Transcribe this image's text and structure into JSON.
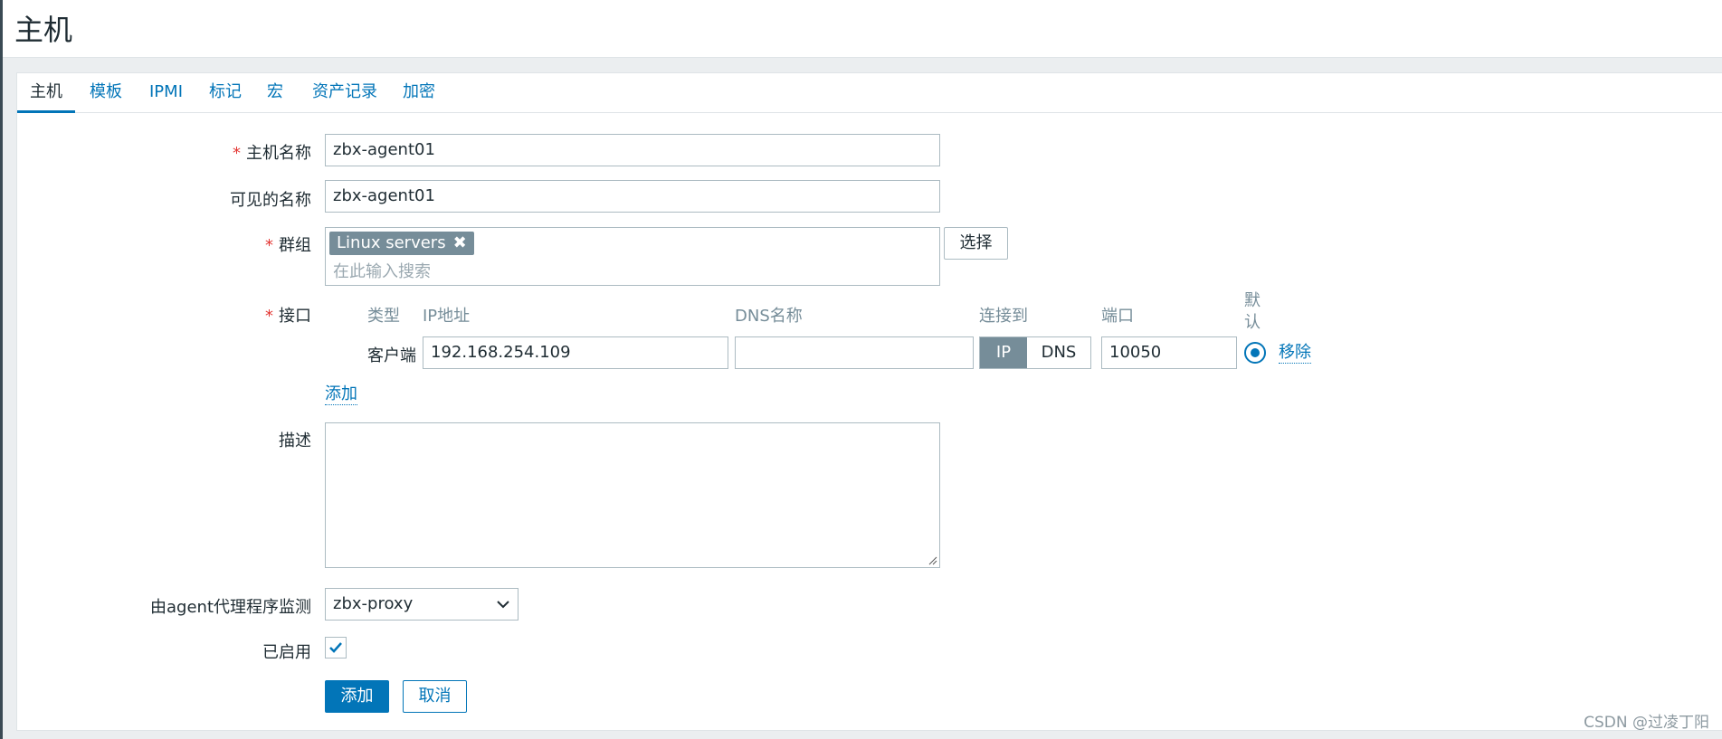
{
  "page": {
    "title": "主机"
  },
  "tabs": [
    {
      "label": "主机",
      "active": true
    },
    {
      "label": "模板"
    },
    {
      "label": "IPMI"
    },
    {
      "label": "标记"
    },
    {
      "label": "宏"
    },
    {
      "label": "资产记录"
    },
    {
      "label": "加密"
    }
  ],
  "form": {
    "required_mark": "*",
    "host_name": {
      "label": "主机名称",
      "value": "zbx-agent01"
    },
    "visible_name": {
      "label": "可见的名称",
      "value": "zbx-agent01"
    },
    "groups": {
      "label": "群组",
      "chips": [
        {
          "label": "Linux servers",
          "remove_glyph": "✖"
        }
      ],
      "placeholder": "在此输入搜索",
      "select_button": "选择"
    },
    "interfaces": {
      "label": "接口",
      "columns": {
        "type": "类型",
        "ip": "IP地址",
        "dns": "DNS名称",
        "connect_to": "连接到",
        "port": "端口",
        "default": "默认"
      },
      "rows": [
        {
          "type": "客户端",
          "ip": "192.168.254.109",
          "dns": "",
          "connect_to": "IP",
          "connect_options": [
            "IP",
            "DNS"
          ],
          "port": "10050",
          "default": true,
          "remove_link": "移除"
        }
      ],
      "add_link": "添加"
    },
    "description": {
      "label": "描述",
      "value": ""
    },
    "proxy": {
      "label": "由agent代理程序监测",
      "value": "zbx-proxy"
    },
    "enabled": {
      "label": "已启用",
      "checked": true
    },
    "buttons": {
      "add": "添加",
      "cancel": "取消"
    }
  },
  "icons": {
    "chip_remove": "close-icon",
    "select_chevron": "chevron-down-icon",
    "checkbox": "check-icon",
    "textarea_resize": "resize-grip-icon"
  },
  "colors": {
    "accent": "#0275b8",
    "chip": "#768d99",
    "required": "#e33734",
    "background": "#ebeef0"
  },
  "watermark": "CSDN @过凌丁阳"
}
